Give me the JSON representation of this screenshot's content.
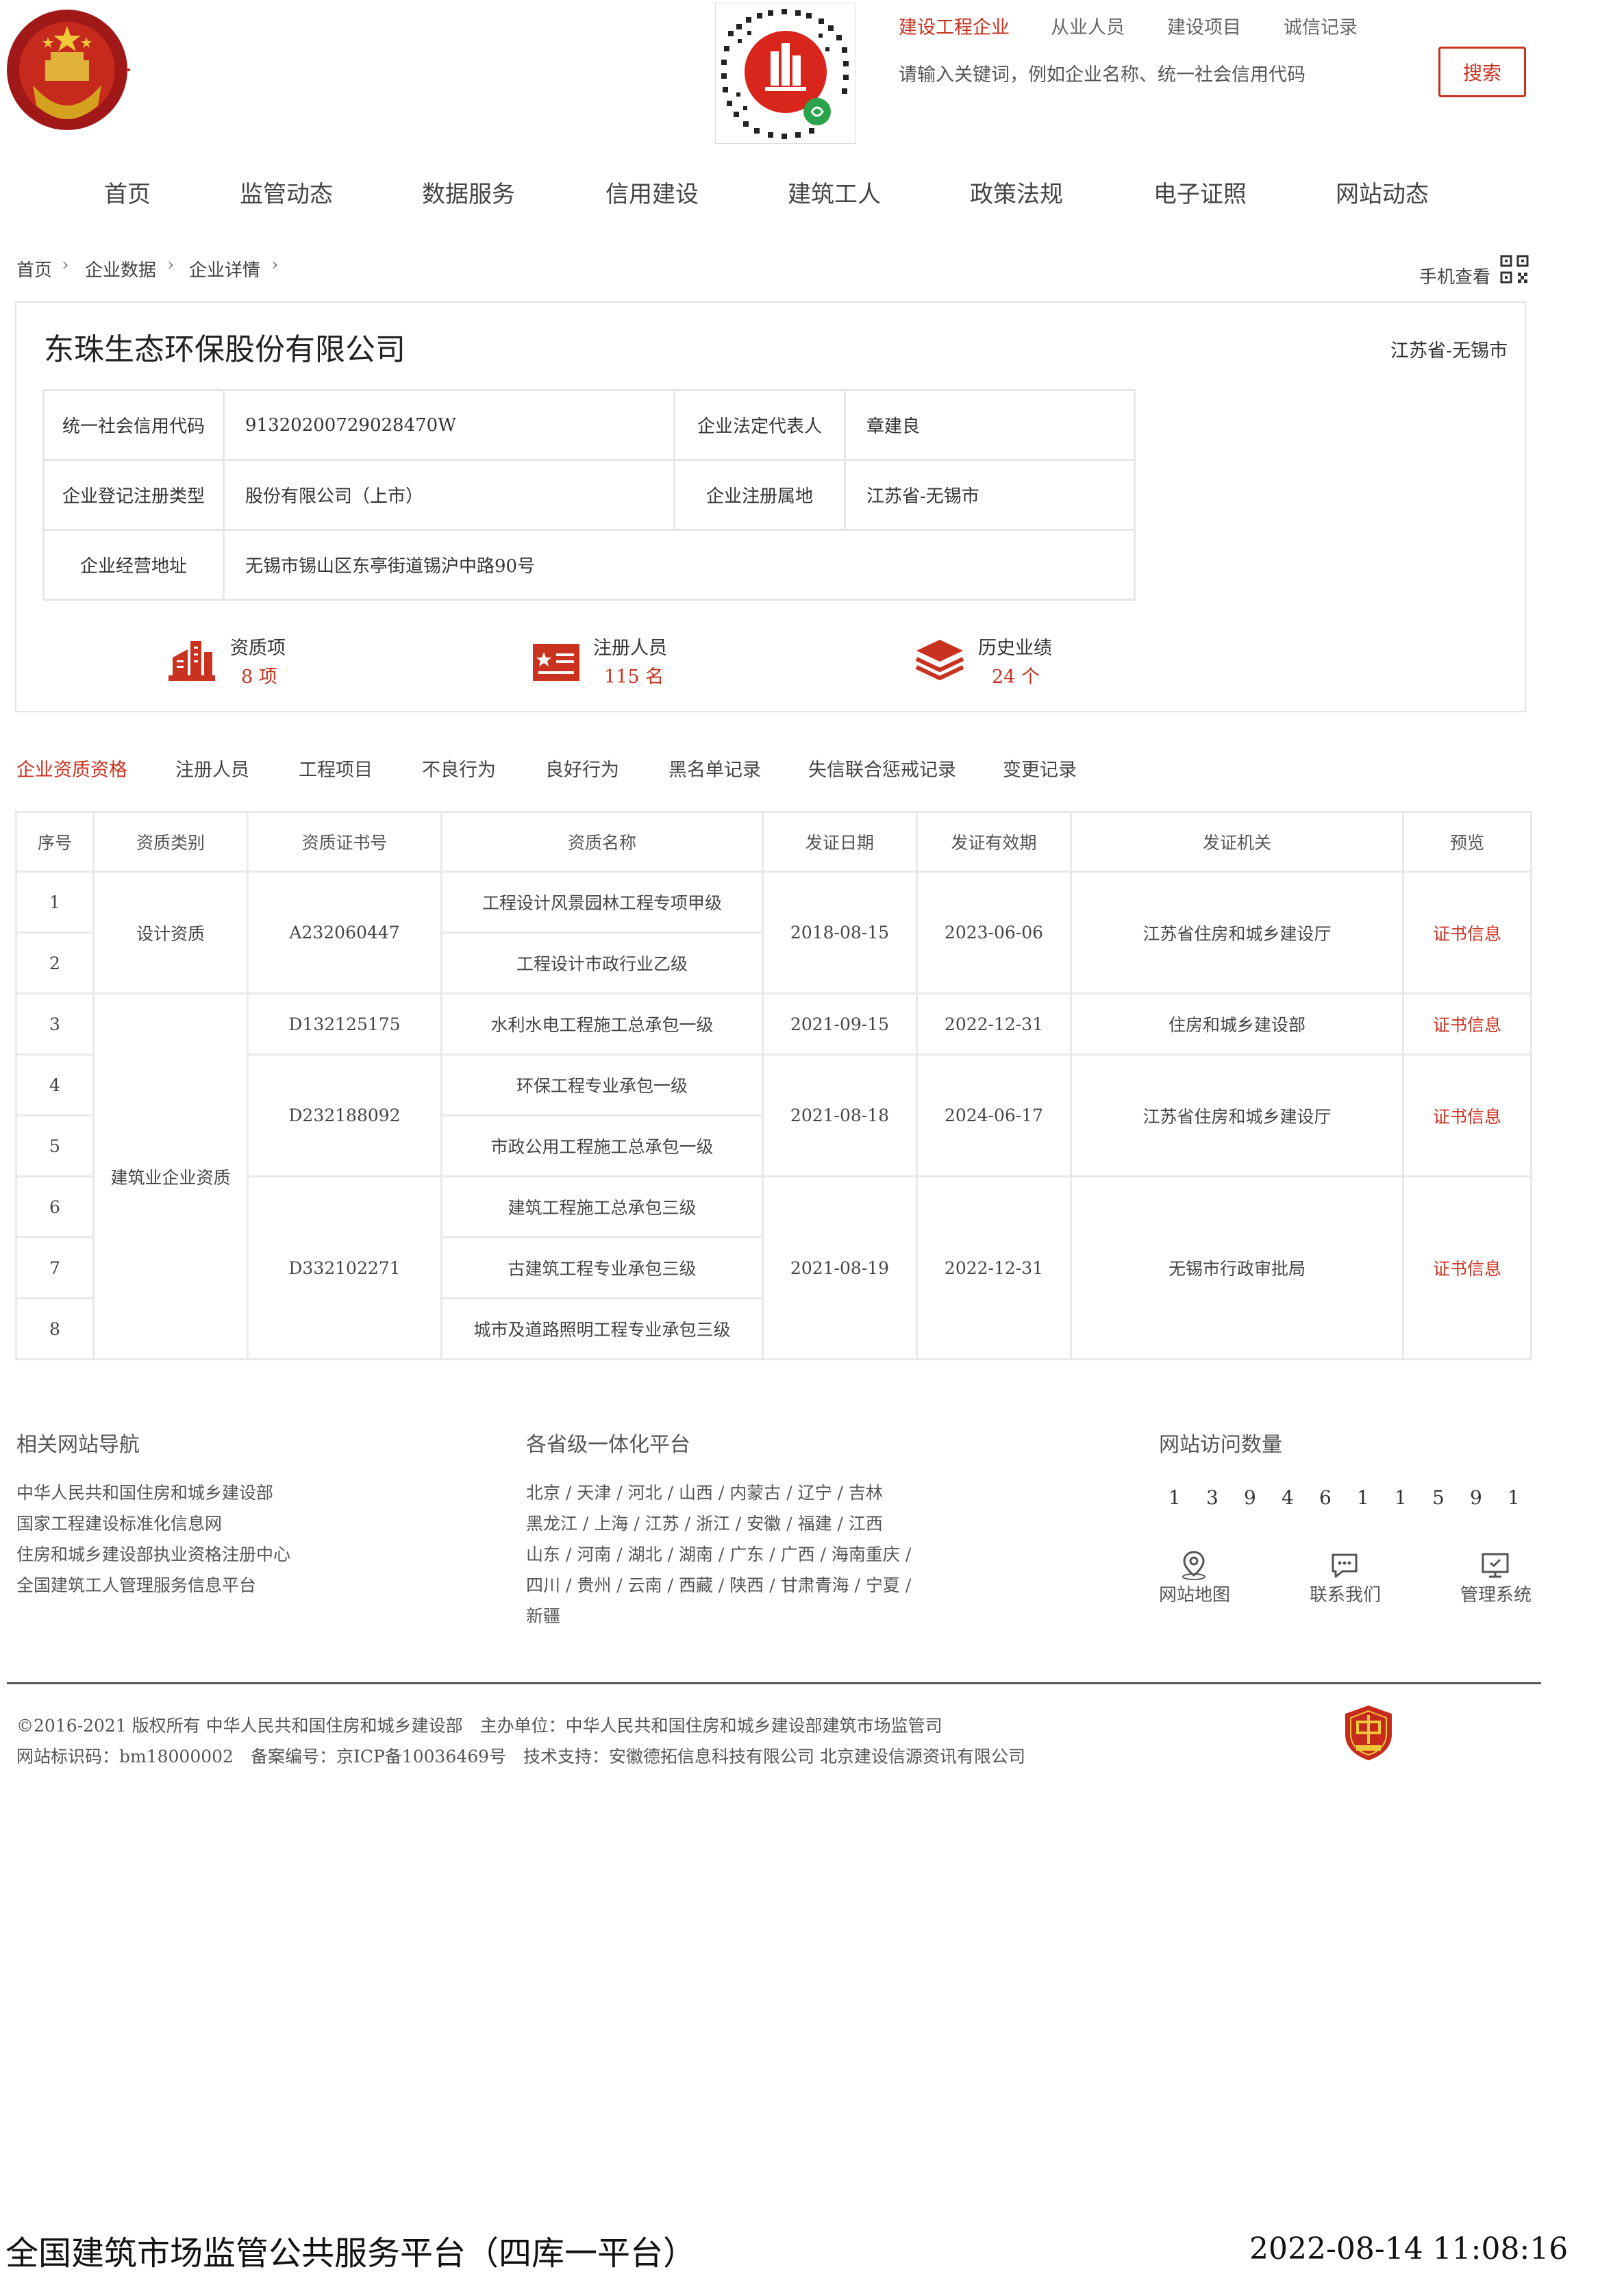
{
  "header": {
    "search_tabs": [
      "建设工程企业",
      "从业人员",
      "建设项目",
      "诚信记录"
    ],
    "search_placeholder": "请输入关键词，例如企业名称、统一社会信用代码",
    "search_button": "搜索"
  },
  "nav": [
    "首页",
    "监管动态",
    "数据服务",
    "信用建设",
    "建筑工人",
    "政策法规",
    "电子证照",
    "网站动态"
  ],
  "breadcrumb": [
    "首页",
    "企业数据",
    "企业详情"
  ],
  "mobile_view": "手机查看",
  "company": {
    "name": "东珠生态环保股份有限公司",
    "region": "江苏省-无锡市",
    "credit_code_label": "统一社会信用代码",
    "credit_code": "91320200729028470W",
    "legal_rep_label": "企业法定代表人",
    "legal_rep": "章建良",
    "reg_type_label": "企业登记注册类型",
    "reg_type": "股份有限公司（上市）",
    "reg_place_label": "企业注册属地",
    "reg_place": "江苏省-无锡市",
    "address_label": "企业经营地址",
    "address": "无锡市锡山区东亭街道锡沪中路90号"
  },
  "stats": [
    {
      "label": "资质项",
      "value": "8 项",
      "icon": "building-icon"
    },
    {
      "label": "注册人员",
      "value": "115 名",
      "icon": "id-card-icon"
    },
    {
      "label": "历史业绩",
      "value": "24 个",
      "icon": "layers-icon"
    }
  ],
  "tabs": [
    "企业资质资格",
    "注册人员",
    "工程项目",
    "不良行为",
    "良好行为",
    "黑名单记录",
    "失信联合惩戒记录",
    "变更记录"
  ],
  "qual_table": {
    "headers": [
      "序号",
      "资质类别",
      "资质证书号",
      "资质名称",
      "发证日期",
      "发证有效期",
      "发证机关",
      "预览"
    ],
    "categories": [
      "设计资质",
      "建筑业企业资质"
    ],
    "certs": [
      {
        "no": "A232060447",
        "date": "2018-08-15",
        "valid": "2023-06-06",
        "issuer": "江苏省住房和城乡建设厅",
        "preview": "证书信息"
      },
      {
        "no": "D132125175",
        "date": "2021-09-15",
        "valid": "2022-12-31",
        "issuer": "住房和城乡建设部",
        "preview": "证书信息"
      },
      {
        "no": "D232188092",
        "date": "2021-08-18",
        "valid": "2024-06-17",
        "issuer": "江苏省住房和城乡建设厅",
        "preview": "证书信息"
      },
      {
        "no": "D332102271",
        "date": "2021-08-19",
        "valid": "2022-12-31",
        "issuer": "无锡市行政审批局",
        "preview": "证书信息"
      }
    ],
    "rows": [
      {
        "seq": "1",
        "name": "工程设计风景园林工程专项甲级"
      },
      {
        "seq": "2",
        "name": "工程设计市政行业乙级"
      },
      {
        "seq": "3",
        "name": "水利水电工程施工总承包一级"
      },
      {
        "seq": "4",
        "name": "环保工程专业承包一级"
      },
      {
        "seq": "5",
        "name": "市政公用工程施工总承包一级"
      },
      {
        "seq": "6",
        "name": "建筑工程施工总承包三级"
      },
      {
        "seq": "7",
        "name": "古建筑工程专业承包三级"
      },
      {
        "seq": "8",
        "name": "城市及道路照明工程专业承包三级"
      }
    ]
  },
  "footer": {
    "related_title": "相关网站导航",
    "related_links": [
      "中华人民共和国住房和城乡建设部",
      "国家工程建设标准化信息网",
      "住房和城乡建设部执业资格注册中心",
      "全国建筑工人管理服务信息平台"
    ],
    "provinces_title": "各省级一体化平台",
    "province_lines": [
      "北京 / 天津 / 河北 / 山西 / 内蒙古 / 辽宁 / 吉林",
      "黑龙江 / 上海 / 江苏 / 浙江 / 安徽 / 福建 / 江西",
      "山东 / 河南 / 湖北 / 湖南 / 广东 / 广西 / 海南重庆 /",
      "四川 / 贵州 / 云南 / 西藏 / 陕西 / 甘肃青海 / 宁夏 /",
      "新疆"
    ],
    "visits_title": "网站访问数量",
    "visit_digits": [
      "1",
      "3",
      "9",
      "4",
      "6",
      "1",
      "1",
      "5",
      "9",
      "1"
    ],
    "icon_links": [
      {
        "label": "网站地图",
        "icon": "map-pin-icon"
      },
      {
        "label": "联系我们",
        "icon": "chat-bubble-icon"
      },
      {
        "label": "管理系统",
        "icon": "monitor-icon"
      }
    ],
    "copyright_line1": "©2016-2021 版权所有 中华人民共和国住房和城乡建设部　主办单位：中华人民共和国住房和城乡建设部建筑市场监管司",
    "copyright_line2": "网站标识码：bm18000002　备案编号：京ICP备10036469号　技术支持：安徽德拓信息科技有限公司 北京建设信源资讯有限公司"
  },
  "bottom_bar": {
    "title": "全国建筑市场监管公共服务平台（四库一平台）",
    "datetime": "2022-08-14 11:08:16"
  },
  "colors": {
    "accent": "#c8321e",
    "border": "#e6e6e6",
    "text": "#333333"
  }
}
